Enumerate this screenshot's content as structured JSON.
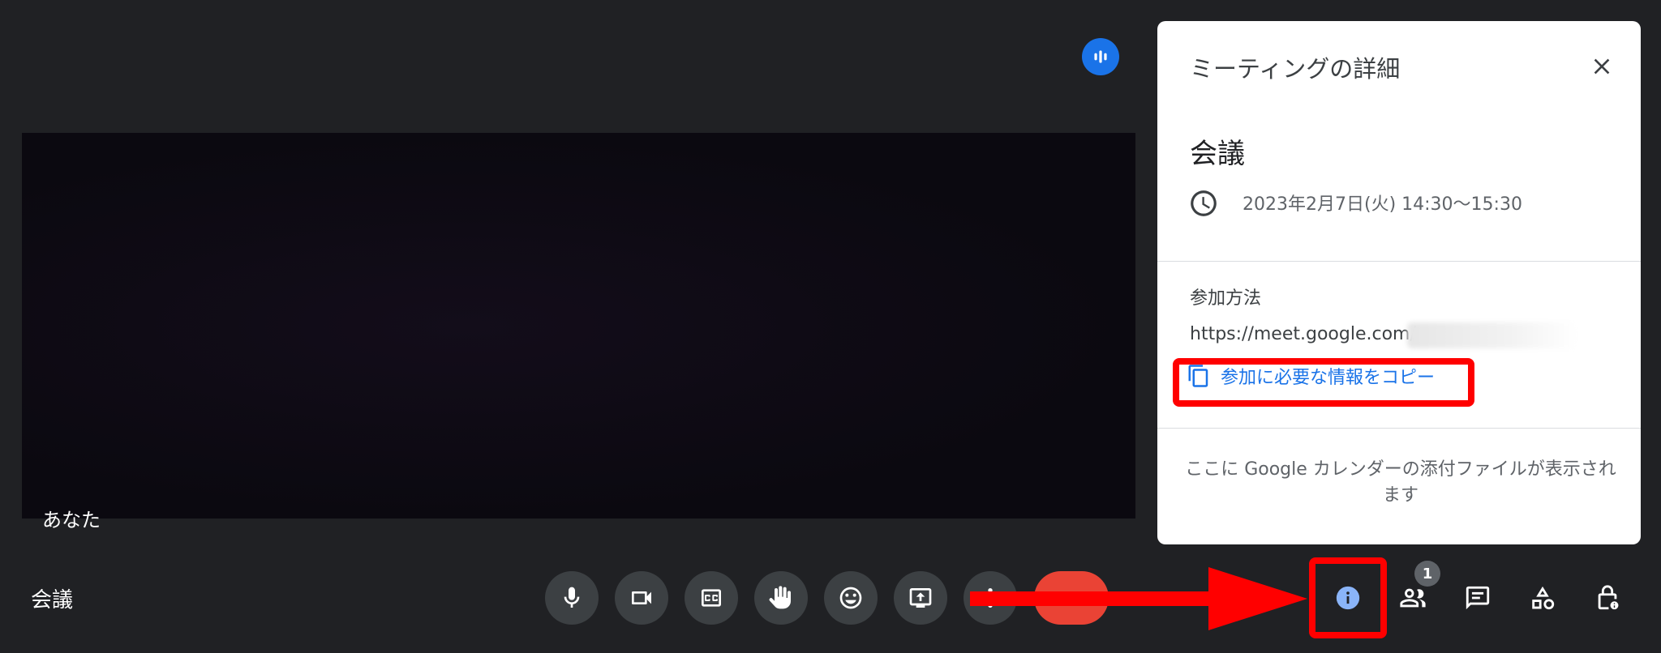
{
  "meeting": {
    "name": "会議",
    "self_label": "あなた"
  },
  "panel": {
    "title": "ミーティングの詳細",
    "event_title": "会議",
    "datetime": "2023年2月7日(火) 14:30～15:30",
    "join_heading": "参加方法",
    "join_url": "https://meet.google.com/",
    "copy_label": "参加に必要な情報をコピー",
    "attachments_note": "ここに Google カレンダーの添付ファイルが表示されます"
  },
  "controls": [
    {
      "name": "microphone",
      "icon": "mic-icon"
    },
    {
      "name": "camera",
      "icon": "videocam-icon"
    },
    {
      "name": "captions",
      "icon": "cc-icon"
    },
    {
      "name": "raise-hand",
      "icon": "hand-icon"
    },
    {
      "name": "reactions",
      "icon": "emoji-icon"
    },
    {
      "name": "present",
      "icon": "present-icon"
    },
    {
      "name": "more-options",
      "icon": "more-vert-icon"
    },
    {
      "name": "end-call",
      "icon": "end-call-icon"
    }
  ],
  "right_controls": {
    "participants_count": "1",
    "items": [
      "info-icon",
      "people-icon",
      "chat-icon",
      "activities-icon",
      "host-controls-icon"
    ]
  },
  "colors": {
    "background": "#202124",
    "accent": "#1a73e8",
    "end_call": "#ea4335",
    "annotation": "#ff0000"
  }
}
